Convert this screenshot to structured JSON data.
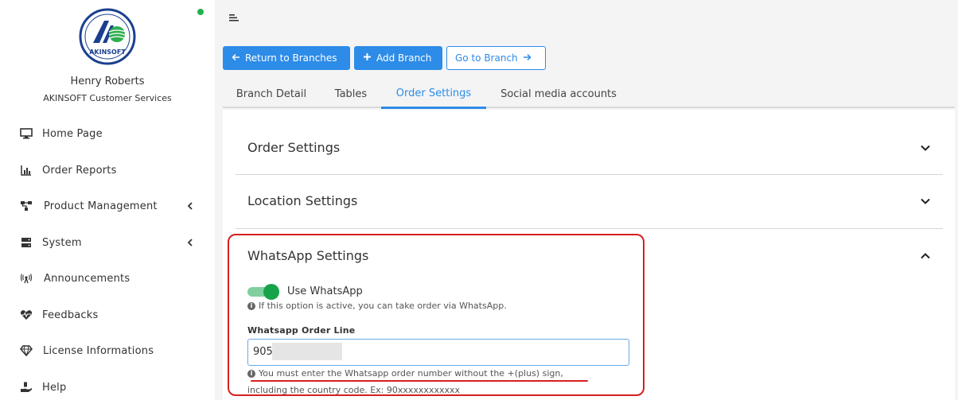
{
  "user": {
    "name": "Henry Roberts",
    "company": "AKINSOFT Customer Services",
    "logo_text": "AKINSOFT"
  },
  "sidebar": {
    "items": [
      {
        "label": "Home Page",
        "icon": "monitor-icon",
        "has_submenu": false
      },
      {
        "label": "Order Reports",
        "icon": "bar-chart-icon",
        "has_submenu": false
      },
      {
        "label": "Product Management",
        "icon": "network-icon",
        "has_submenu": true
      },
      {
        "label": "System",
        "icon": "server-icon",
        "has_submenu": true
      },
      {
        "label": "Announcements",
        "icon": "broadcast-icon",
        "has_submenu": false
      },
      {
        "label": "Feedbacks",
        "icon": "heartbeat-icon",
        "has_submenu": false
      },
      {
        "label": "License Informations",
        "icon": "diamond-icon",
        "has_submenu": false
      },
      {
        "label": "Help",
        "icon": "hand-holding-icon",
        "has_submenu": false
      }
    ]
  },
  "toolbar": {
    "return_label": "Return to Branches",
    "add_label": "Add Branch",
    "goto_label": "Go to Branch"
  },
  "tabs": [
    {
      "label": "Branch Detail",
      "active": false
    },
    {
      "label": "Tables",
      "active": false
    },
    {
      "label": "Order Settings",
      "active": true
    },
    {
      "label": "Social media accounts",
      "active": false
    }
  ],
  "sections": {
    "order": {
      "title": "Order Settings",
      "expanded": false
    },
    "location": {
      "title": "Location Settings",
      "expanded": false
    },
    "whatsapp": {
      "title": "WhatsApp Settings",
      "expanded": true
    }
  },
  "whatsapp": {
    "toggle_label": "Use WhatsApp",
    "toggle_on": true,
    "toggle_help": "If this option is active, you can take order via WhatsApp.",
    "order_line_label": "Whatsapp Order Line",
    "order_line_value": "905",
    "warning_line1": "You must enter the Whatsapp order number without the +(plus) sign,",
    "warning_line2": "including the country code. Ex: 90xxxxxxxxxxxx"
  },
  "colors": {
    "primary": "#2d8ce8",
    "toggle_on": "#17a34a",
    "highlight": "#d62020",
    "online": "#22b14c"
  }
}
